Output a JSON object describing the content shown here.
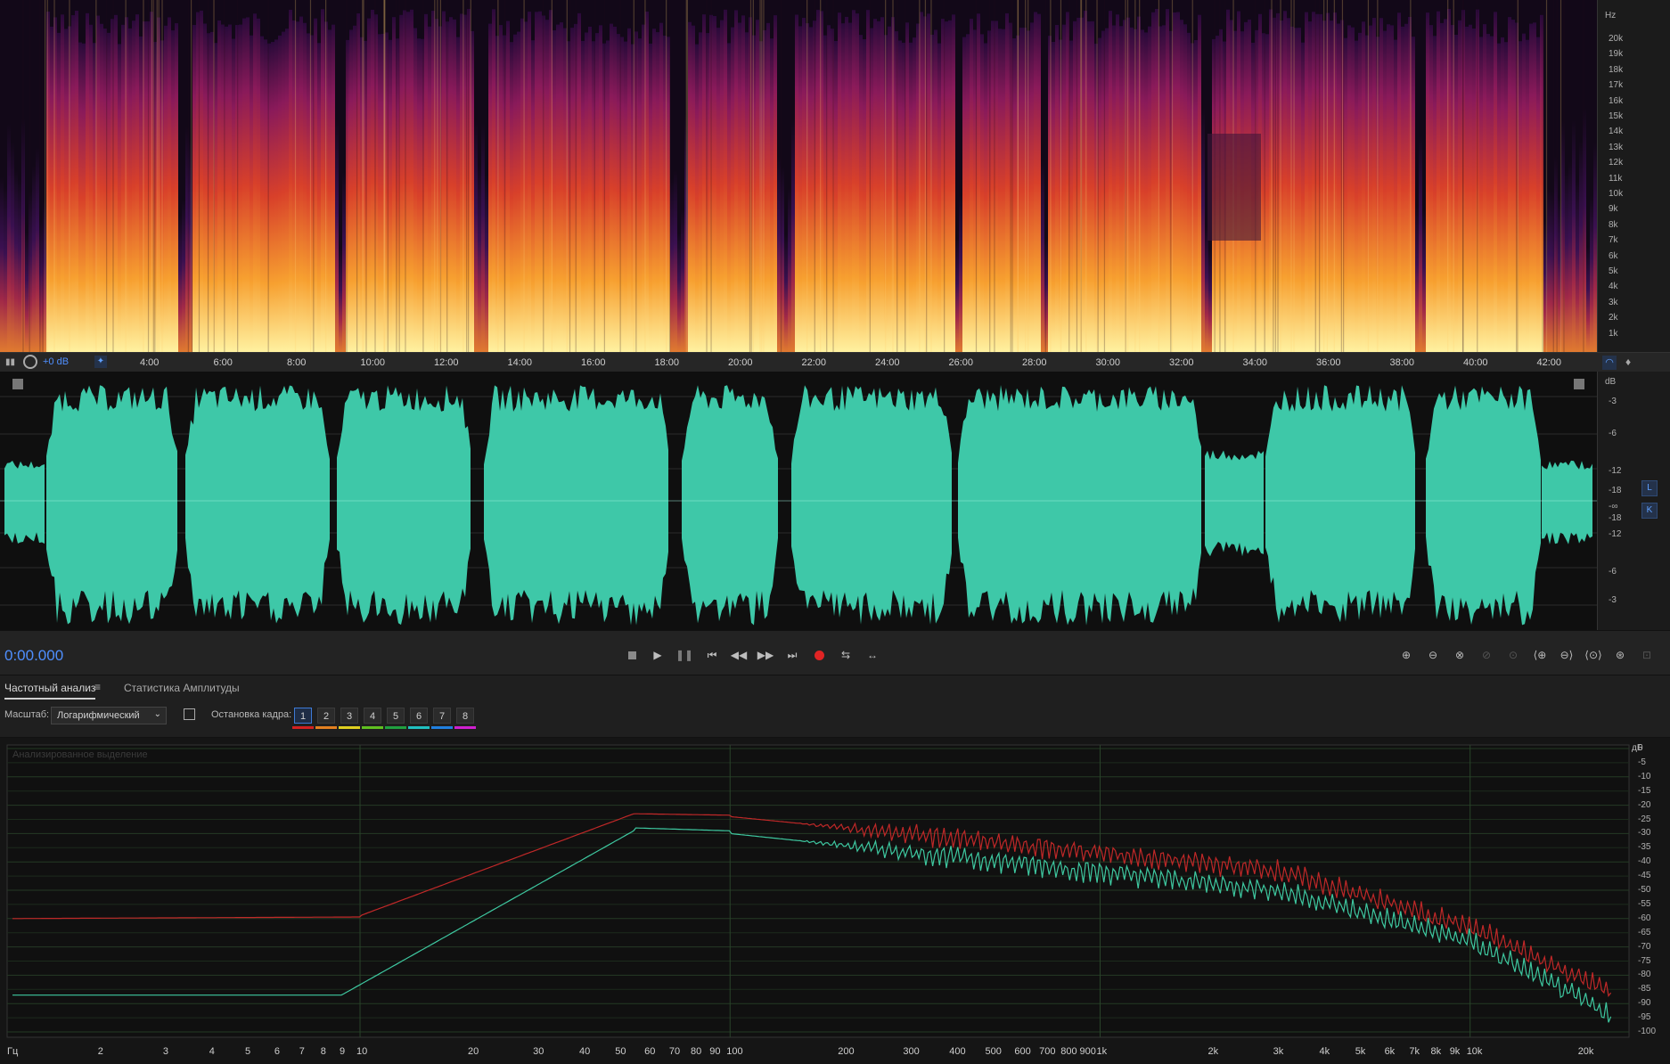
{
  "spectral": {
    "unit": "Hz",
    "labels": [
      "20k",
      "19k",
      "18k",
      "17k",
      "16k",
      "15k",
      "14k",
      "13k",
      "12k",
      "11k",
      "10k",
      "9k",
      "8k",
      "7k",
      "6k",
      "5k",
      "4k",
      "3k",
      "2k",
      "1k"
    ]
  },
  "ruler": {
    "gain": "+0 dB",
    "times": [
      "4:00",
      "6:00",
      "8:00",
      "10:00",
      "12:00",
      "14:00",
      "16:00",
      "18:00",
      "20:00",
      "22:00",
      "24:00",
      "26:00",
      "28:00",
      "30:00",
      "32:00",
      "34:00",
      "36:00",
      "38:00",
      "40:00",
      "42:00"
    ]
  },
  "waveform": {
    "unit": "dB",
    "labels_top": [
      "-3",
      "-6",
      "-12",
      "-18",
      "-∞"
    ],
    "labels_bottom": [
      "-18",
      "-12",
      "-6",
      "-3"
    ],
    "channel_left": "L",
    "channel_right": "K",
    "wave_color": "#3ec8a8"
  },
  "transport": {
    "time": "0:00.000"
  },
  "tabs": {
    "frequency_analysis": "Частотный анализ",
    "amplitude_stats": "Статистика Амплитуды"
  },
  "controls": {
    "scale_label": "Масштаб:",
    "scale_value": "Логарифмический",
    "freeze_label": "Остановка кадра:",
    "frames": [
      "1",
      "2",
      "3",
      "4",
      "5",
      "6",
      "7",
      "8"
    ],
    "frame_colors": [
      "#d32020",
      "#e38020",
      "#e0d020",
      "#60c020",
      "#20a040",
      "#20c0c0",
      "#2080e0",
      "#d020d0"
    ]
  },
  "analysis": {
    "overlay": "Анализированное выделение",
    "db_unit": "дБ",
    "db_labels": [
      "0",
      "-5",
      "-10",
      "-15",
      "-20",
      "-25",
      "-30",
      "-35",
      "-40",
      "-45",
      "-50",
      "-55",
      "-60",
      "-65",
      "-70",
      "-75",
      "-80",
      "-85",
      "-90",
      "-95",
      "-100"
    ],
    "hz_unit": "Гц",
    "freq_labels": [
      "2",
      "3",
      "4",
      "5",
      "6",
      "7",
      "8",
      "9",
      "10",
      "20",
      "30",
      "40",
      "50",
      "60",
      "70",
      "80",
      "90",
      "100",
      "200",
      "300",
      "400",
      "500",
      "600",
      "700",
      "800",
      "900",
      "1k",
      "2k",
      "3k",
      "4k",
      "5k",
      "6k",
      "7k",
      "8k",
      "9k",
      "10k",
      "20k"
    ],
    "series_colors": [
      "#c02828",
      "#3ec8a0"
    ]
  }
}
